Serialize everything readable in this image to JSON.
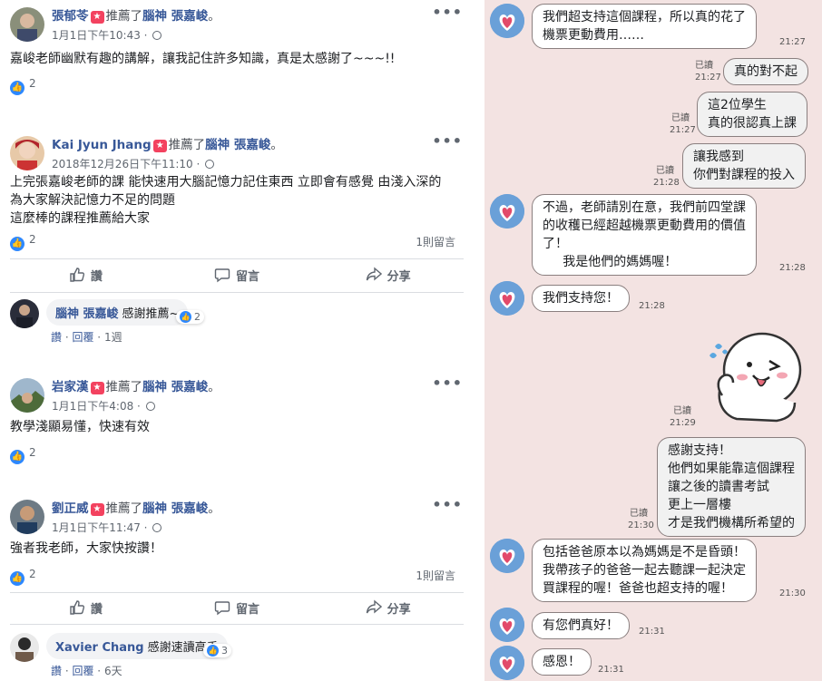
{
  "recommend_text": "推薦了",
  "page_name": "腦神 張嘉峻",
  "actions": {
    "like": "讚",
    "comment": "留言",
    "share": "分享"
  },
  "posts": [
    {
      "name": "張郁苓",
      "time": "1月1日下午10:43",
      "body": "嘉峻老師幽默有趣的講解，讓我記住許多知識，真是太感謝了~~~!!",
      "likes": "2"
    },
    {
      "name": "Kai Jyun Jhang",
      "time": "2018年12月26日下午11:10",
      "body": "上完張嘉峻老師的課 能快速用大腦記憶力記住東西 立即會有感覺 由淺入深的\n為大家解決記憶力不足的問題\n這麼棒的課程推薦給大家",
      "likes": "2",
      "comments": "1則留言",
      "reply": {
        "name": "腦神 張嘉峻",
        "text": "感謝推薦~",
        "likes": "2",
        "like_label": "讚",
        "reply_label": "回覆",
        "age": "1週"
      }
    },
    {
      "name": "岩家漢",
      "time": "1月1日下午4:08",
      "body": "教學淺顯易懂，快速有效",
      "likes": "2"
    },
    {
      "name": "劉正威",
      "time": "1月1日下午11:47",
      "body": "強者我老師，大家快按讚！",
      "likes": "2",
      "comments": "1則留言",
      "reply": {
        "name": "Xavier Chang",
        "text": "感謝速讀高手",
        "likes": "3",
        "like_label": "讚",
        "reply_label": "回覆",
        "age": "6天"
      }
    }
  ],
  "chat": [
    {
      "side": "left",
      "text": "我們超支持這個課程，所以真的花了\n機票更動費用……",
      "time": "21:27"
    },
    {
      "side": "right",
      "text": "真的對不起",
      "read": "已讀",
      "time": "21:27"
    },
    {
      "side": "right",
      "text": "這2位學生\n真的很認真上課",
      "read": "已讀",
      "time": "21:27"
    },
    {
      "side": "right",
      "text": "讓我感到\n你們對課程的投入",
      "read": "已讀",
      "time": "21:28"
    },
    {
      "side": "left",
      "text": "不過，老師請別在意，我們前四堂課\n的收穫已經超越機票更動費用的價值\n了！\n     我是他們的媽媽喔！",
      "time": "21:28"
    },
    {
      "side": "left",
      "text": "我們支持您！",
      "time": "21:28"
    },
    {
      "side": "right",
      "text": "",
      "read": "已讀",
      "time": "21:29",
      "sticker": true
    },
    {
      "side": "right",
      "text": "感謝支持！\n他們如果能靠這個課程\n讓之後的讀書考試\n更上一層樓\n才是我們機構所希望的",
      "read": "已讀",
      "time": "21:30"
    },
    {
      "side": "left",
      "text": "包括爸爸原本以為媽媽是不是昏頭！\n我帶孩子的爸爸一起去聽課一起決定\n買課程的喔！爸爸也超支持的喔！",
      "time": "21:30"
    },
    {
      "side": "left",
      "text": "有您們真好！",
      "time": "21:31"
    },
    {
      "side": "left",
      "text": "感恩！",
      "time": "21:31"
    }
  ]
}
